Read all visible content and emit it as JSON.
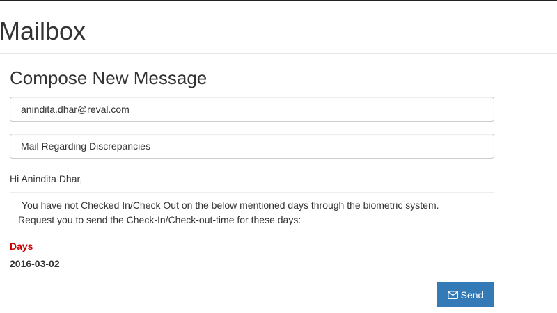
{
  "header": {
    "title": "Mailbox"
  },
  "compose": {
    "title": "Compose New Message",
    "to_value": "anindita.dhar@reval.com",
    "subject_value": "Mail Regarding Discrepancies"
  },
  "message": {
    "greeting": "Hi Anindita Dhar,",
    "line1": "You have not Checked In/Check Out on the below mentioned days through the biometric system.",
    "line2": "Request you to send the Check-In/Check-out-time for these days:",
    "days_label": "Days",
    "days": [
      "2016-03-02"
    ]
  },
  "actions": {
    "send_label": "Send",
    "send_icon": "envelope-icon"
  },
  "colors": {
    "primary_button": "#337ab7",
    "days_label": "#cc0000"
  }
}
